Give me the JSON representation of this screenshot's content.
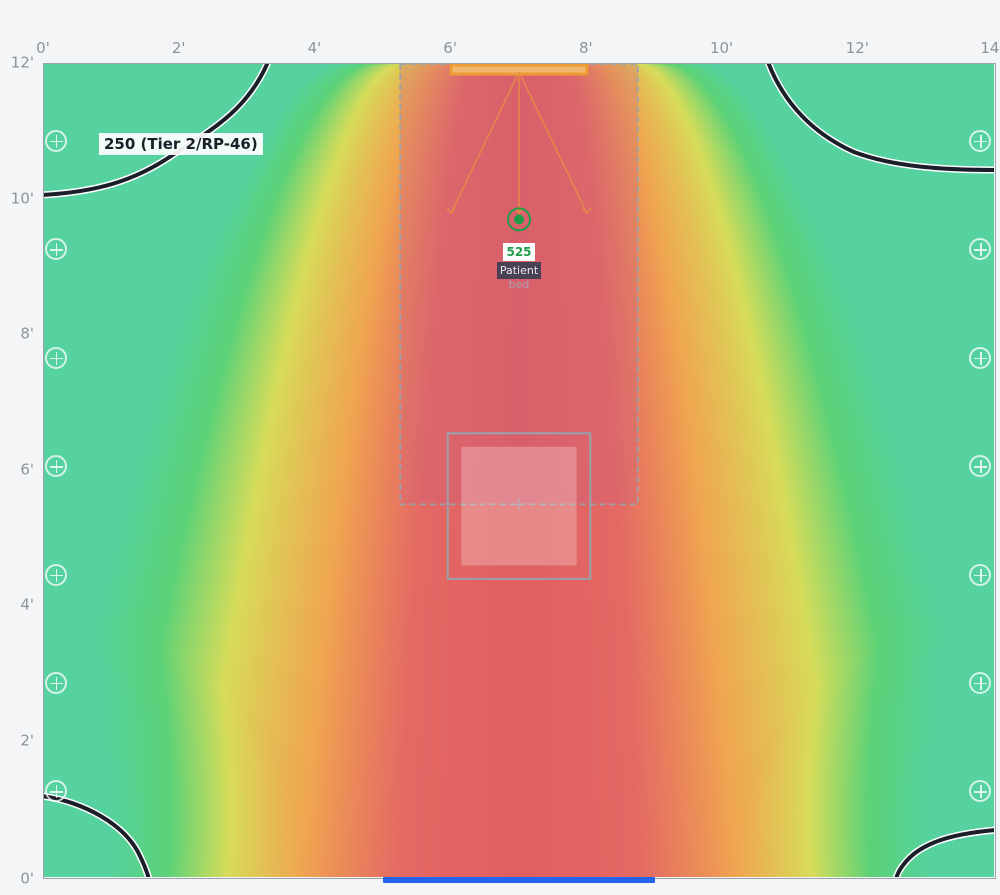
{
  "axes": {
    "x_unit": "ft",
    "y_unit": "ft",
    "x_range": [
      0,
      14
    ],
    "y_range": [
      0,
      12
    ],
    "x_ticks": [
      {
        "value": 0,
        "label": "0'"
      },
      {
        "value": 2,
        "label": "2'"
      },
      {
        "value": 4,
        "label": "4'"
      },
      {
        "value": 6,
        "label": "6'"
      },
      {
        "value": 8,
        "label": "8'"
      },
      {
        "value": 10,
        "label": "10'"
      },
      {
        "value": 12,
        "label": "12'"
      },
      {
        "value": 14,
        "label": "14'"
      }
    ],
    "y_ticks": [
      {
        "value": 12,
        "label": "12'"
      },
      {
        "value": 10,
        "label": "10'"
      },
      {
        "value": 8,
        "label": "8'"
      },
      {
        "value": 6,
        "label": "6'"
      },
      {
        "value": 4,
        "label": "4'"
      },
      {
        "value": 2,
        "label": "2'"
      },
      {
        "value": 0,
        "label": "0'"
      }
    ]
  },
  "contour": {
    "label": "250 (Tier 2/RP-46)",
    "level": 250
  },
  "peak": {
    "value": "525",
    "x": 7.0,
    "y": 9.5
  },
  "bed": {
    "tag": "Patient",
    "tag_tail": "bed",
    "x_range": [
      5.25,
      8.75
    ],
    "y_range": [
      5.5,
      12.0
    ]
  },
  "fixture": {
    "x_range": [
      6.0,
      8.0
    ],
    "y": 12.0,
    "color": "#f0a030"
  },
  "table_square": {
    "outer_x": [
      5.95,
      8.05
    ],
    "outer_y": [
      4.4,
      6.55
    ],
    "inner_x": [
      6.15,
      7.85
    ],
    "inner_y": [
      4.6,
      6.35
    ]
  },
  "door": {
    "x_range": [
      5.0,
      9.0
    ],
    "color": "#2563eb"
  },
  "add_points": [
    {
      "name": "add-point-left-1",
      "x": 0.2,
      "y": 10.85
    },
    {
      "name": "add-point-left-2",
      "x": 0.2,
      "y": 9.25
    },
    {
      "name": "add-point-left-3",
      "x": 0.2,
      "y": 7.65
    },
    {
      "name": "add-point-left-4",
      "x": 0.2,
      "y": 6.05
    },
    {
      "name": "add-point-left-5",
      "x": 0.2,
      "y": 4.45
    },
    {
      "name": "add-point-left-6",
      "x": 0.2,
      "y": 2.85
    },
    {
      "name": "add-point-left-7",
      "x": 0.2,
      "y": 1.25
    },
    {
      "name": "add-point-right-1",
      "x": 13.8,
      "y": 10.85
    },
    {
      "name": "add-point-right-2",
      "x": 13.8,
      "y": 9.25
    },
    {
      "name": "add-point-right-3",
      "x": 13.8,
      "y": 7.65
    },
    {
      "name": "add-point-right-4",
      "x": 13.8,
      "y": 6.05
    },
    {
      "name": "add-point-right-5",
      "x": 13.8,
      "y": 4.45
    },
    {
      "name": "add-point-right-6",
      "x": 13.8,
      "y": 2.85
    },
    {
      "name": "add-point-right-7",
      "x": 13.8,
      "y": 1.25
    }
  ],
  "colors": {
    "high": "#e06464",
    "mid_high": "#f0a050",
    "mid": "#dcdc5a",
    "low": "#5cd28c",
    "lowest": "#55d2a0",
    "contour_line": "#1b1f29",
    "bed_overlay": "#c86080",
    "peak_marker": "#1e9c4a"
  }
}
